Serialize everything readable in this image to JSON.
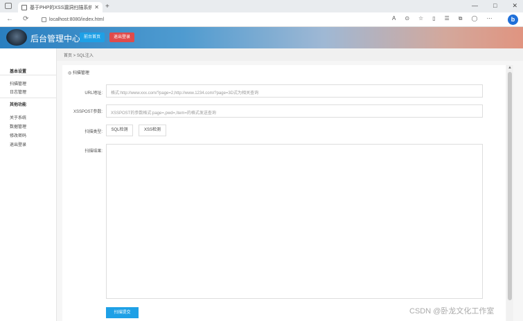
{
  "browser": {
    "tab_title": "基于PHP的XSS漏洞扫描系统",
    "new_tab": "+",
    "url": "localhost:8080/index.html",
    "win_controls": [
      "—",
      "□",
      "✕"
    ],
    "back": "←",
    "reload": "⟳"
  },
  "header": {
    "app_title": "后台管理中心",
    "btn_home": "前台首页",
    "btn_logout": "退出登录"
  },
  "breadcrumb": "首页  >  SQL注入",
  "sidebar": {
    "group1": "基本设置",
    "group1_items": [
      "扫描管理",
      "日志管理"
    ],
    "group2": "其他功能",
    "group2_items": [
      "关于系统",
      "数据管理",
      "修改密码",
      "退出登录"
    ]
  },
  "panel": {
    "title": "◎ 扫描管理",
    "url_label": "URL地址:",
    "url_placeholder": "格式:http://www.xxx.com/?page=2,http://www.1234.com/?page=3D式为相关查询",
    "xss_label": "XSSPOST参数:",
    "xss_placeholder": "XSSPOST的参数格式:page=,pwd=,Item=的格式发送查询",
    "type_label": "扫描类型:",
    "btn_sql": "SQL检测",
    "btn_xss": "XSS检测",
    "result_label": "扫描结果:",
    "submit": "扫描提交"
  },
  "watermark": "CSDN @卧龙文化工作室"
}
